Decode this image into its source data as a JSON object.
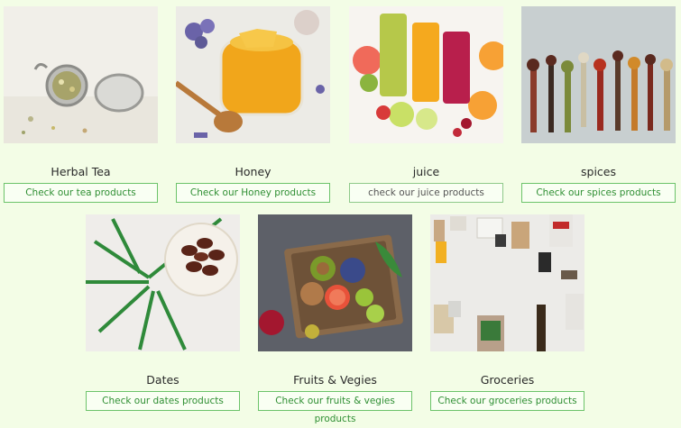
{
  "categories": [
    {
      "title": "Herbal Tea",
      "button": "Check our tea products"
    },
    {
      "title": "Honey",
      "button": "Check our Honey products"
    },
    {
      "title": "juice",
      "button": "check our juice products"
    },
    {
      "title": "spices",
      "button": "Check our spices products"
    },
    {
      "title": "Dates",
      "button": "Check our dates products"
    },
    {
      "title": "Fruits & Vegies",
      "button": "Check our fruits & vegies products"
    },
    {
      "title": "Groceries",
      "button": "Check our groceries products"
    }
  ],
  "colors": {
    "background": "#f3fde6",
    "button_border": "#6cc36a",
    "button_text": "#2f8f33"
  }
}
